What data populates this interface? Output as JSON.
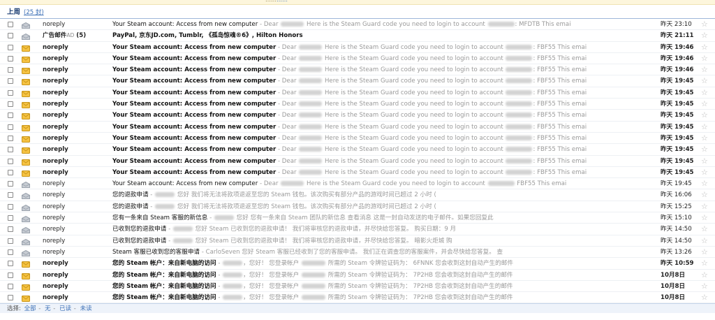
{
  "notice": {
    "text": "……",
    "link": "……"
  },
  "group": {
    "title": "上周",
    "count": "(25 封)"
  },
  "colors": {
    "unread_icon": "#f5c242",
    "read_icon": "#c7ccd3",
    "link": "#3b6fb6"
  },
  "emails": [
    {
      "unread": false,
      "sender": "noreply",
      "subject": "Your Steam account: Access from new computer",
      "preview": "Dear [blurred] Here is the Steam Guard code you need to login to account [blurred]: MFDTB This emai",
      "date": "昨天 23:10",
      "icon": "envelope-open-icon"
    },
    {
      "unread": true,
      "sender": "广告邮件",
      "sender_suffix": "(5)",
      "sender_badge": "AD",
      "subject": "PayPal, 京东JD.com, Tumblr, 《孤岛惊魂®6》, Hilton Honors",
      "preview": "",
      "date": "昨天 21:11",
      "icon": "envelope-open-icon"
    },
    {
      "unread": true,
      "sender": "noreply",
      "subject": "Your Steam account: Access from new computer",
      "preview": "Dear [blurred] Here is the Steam Guard code you need to login to account [blurred]: FBF55 This emai",
      "date": "昨天 19:46",
      "icon": "envelope-icon"
    },
    {
      "unread": true,
      "sender": "noreply",
      "subject": "Your Steam account: Access from new computer",
      "preview": "Dear [blurred] Here is the Steam Guard code you need to login to account [blurred]: FBF55 This emai",
      "date": "昨天 19:46",
      "icon": "envelope-icon"
    },
    {
      "unread": true,
      "sender": "noreply",
      "subject": "Your Steam account: Access from new computer",
      "preview": "Dear [blurred] Here is the Steam Guard code you need to login to account [blurred]: FBF55 This emai",
      "date": "昨天 19:46",
      "icon": "envelope-icon"
    },
    {
      "unread": true,
      "sender": "noreply",
      "subject": "Your Steam account: Access from new computer",
      "preview": "Dear [blurred] Here is the Steam Guard code you need to login to account [blurred]: FBF55 This emai",
      "date": "昨天 19:45",
      "icon": "envelope-icon"
    },
    {
      "unread": true,
      "sender": "noreply",
      "subject": "Your Steam account: Access from new computer",
      "preview": "Dear [blurred] Here is the Steam Guard code you need to login to account [blurred]: FBF55 This emai",
      "date": "昨天 19:45",
      "icon": "envelope-icon"
    },
    {
      "unread": true,
      "sender": "noreply",
      "subject": "Your Steam account: Access from new computer",
      "preview": "Dear [blurred] Here is the Steam Guard code you need to login to account [blurred]: FBF55 This emai",
      "date": "昨天 19:45",
      "icon": "envelope-icon"
    },
    {
      "unread": true,
      "sender": "noreply",
      "subject": "Your Steam account: Access from new computer",
      "preview": "Dear [blurred] Here is the Steam Guard code you need to login to account [blurred]: FBF55 This emai",
      "date": "昨天 19:45",
      "icon": "envelope-icon"
    },
    {
      "unread": true,
      "sender": "noreply",
      "subject": "Your Steam account: Access from new computer",
      "preview": "Dear [blurred] Here is the Steam Guard code you need to login to account [blurred]: FBF55 This emai",
      "date": "昨天 19:45",
      "icon": "envelope-icon"
    },
    {
      "unread": true,
      "sender": "noreply",
      "subject": "Your Steam account: Access from new computer",
      "preview": "Dear [blurred] Here is the Steam Guard code you need to login to account [blurred]: FBF55 This emai",
      "date": "昨天 19:45",
      "icon": "envelope-icon"
    },
    {
      "unread": true,
      "sender": "noreply",
      "subject": "Your Steam account: Access from new computer",
      "preview": "Dear [blurred] Here is the Steam Guard code you need to login to account [blurred]: FBF55 This emai",
      "date": "昨天 19:45",
      "icon": "envelope-icon"
    },
    {
      "unread": true,
      "sender": "noreply",
      "subject": "Your Steam account: Access from new computer",
      "preview": "Dear [blurred] Here is the Steam Guard code you need to login to account [blurred]: FBF55 This emai",
      "date": "昨天 19:45",
      "icon": "envelope-icon"
    },
    {
      "unread": true,
      "sender": "noreply",
      "subject": "Your Steam account: Access from new computer",
      "preview": "Dear [blurred] Here is the Steam Guard code you need to login to account [blurred]: FBF55 This emai",
      "date": "昨天 19:45",
      "icon": "envelope-icon"
    },
    {
      "unread": false,
      "sender": "noreply",
      "subject": "Your Steam account: Access from new computer",
      "preview": "Dear [blurred] Here is the Steam Guard code you need to login to account [blurred] FBF55 This emai",
      "date": "昨天 19:45",
      "icon": "envelope-open-icon"
    },
    {
      "unread": false,
      "sender": "noreply",
      "subject": "您的退款申请",
      "preview": "[blurred] 您好 我们将无法将款项退返至您的 Steam 钱包。该次购买有部分产品的游戏时间已超过 2 小时 (",
      "date": "昨天 16:06",
      "icon": "envelope-open-icon"
    },
    {
      "unread": false,
      "sender": "noreply",
      "subject": "您的退款申请",
      "preview": "[blurred] 您好 我们将无法将款项退返至您的 Steam 钱包。该次购买有部分产品的游戏时间已超过 2 小时 (",
      "date": "昨天 15:25",
      "icon": "envelope-open-icon"
    },
    {
      "unread": false,
      "sender": "noreply",
      "subject": "您有一条来自 Steam 客服的新信息",
      "preview": "[blurred] 您好 您有一条来自 Steam 团队的新信息 查看消息 这是一封自动发送的电子邮件。如果您回复此",
      "date": "昨天 15:10",
      "icon": "envelope-open-icon"
    },
    {
      "unread": false,
      "sender": "noreply",
      "subject": "已收到您的退款申请",
      "preview": "[blurred] 您好 Steam 已收到您的退款申请！ 我们将审核您的退款申请，并尽快给您答复。 购买日期：9 月",
      "date": "昨天 14:50",
      "icon": "envelope-open-icon"
    },
    {
      "unread": false,
      "sender": "noreply",
      "subject": "已收到您的退款申请",
      "preview": "[blurred] 您好 Steam 已收到您的退款申请！ 我们将审核您的退款申请，并尽快给您答复。 暗影火炬城 购",
      "date": "昨天 14:50",
      "icon": "envelope-open-icon"
    },
    {
      "unread": false,
      "sender": "noreply",
      "subject": "Steam 客服已收到您的客服申请",
      "preview": "CarloSeven 您好 Steam 客服已经收到了您的客服申请。 我们正在调查您的客服案件，并会尽快给您答复。 查",
      "date": "昨天 13:26",
      "icon": "envelope-open-icon"
    },
    {
      "unread": true,
      "sender": "noreply",
      "subject": "您的 Steam 帐户：来自新电脑的访问",
      "preview": "[blurred]，您好！ 您登录帐户 [blurred] 所需的 Steam 令牌验证码为： 6FNNK 您会收到这封自动产生的邮件",
      "date": "昨天 10:59",
      "icon": "envelope-icon"
    },
    {
      "unread": true,
      "sender": "noreply",
      "subject": "您的 Steam 帐户：来自新电脑的访问",
      "preview": "[blurred]，您好！ 您登录帐户 [blurred] 所需的 Steam 令牌验证码为： 7P2HB 您会收到这封自动产生的邮件",
      "date": "10月8日",
      "icon": "envelope-icon"
    },
    {
      "unread": true,
      "sender": "noreply",
      "subject": "您的 Steam 帐户：来自新电脑的访问",
      "preview": "[blurred]，您好！ 您登录帐户 [blurred] 所需的 Steam 令牌验证码为： 7P2HB 您会收到这封自动产生的邮件",
      "date": "10月8日",
      "icon": "envelope-icon"
    },
    {
      "unread": true,
      "sender": "noreply",
      "subject": "您的 Steam 帐户：来自新电脑的访问",
      "preview": "[blurred]，您好！ 您登录帐户 [blurred] 所需的 Steam 令牌验证码为： 7P2HB 您会收到这封自动产生的邮件",
      "date": "10月8日",
      "icon": "envelope-icon"
    }
  ],
  "footer": {
    "label": "选择:",
    "all": "全部",
    "none": "无",
    "read": "已读",
    "unread": "未读",
    "sep": "-"
  }
}
